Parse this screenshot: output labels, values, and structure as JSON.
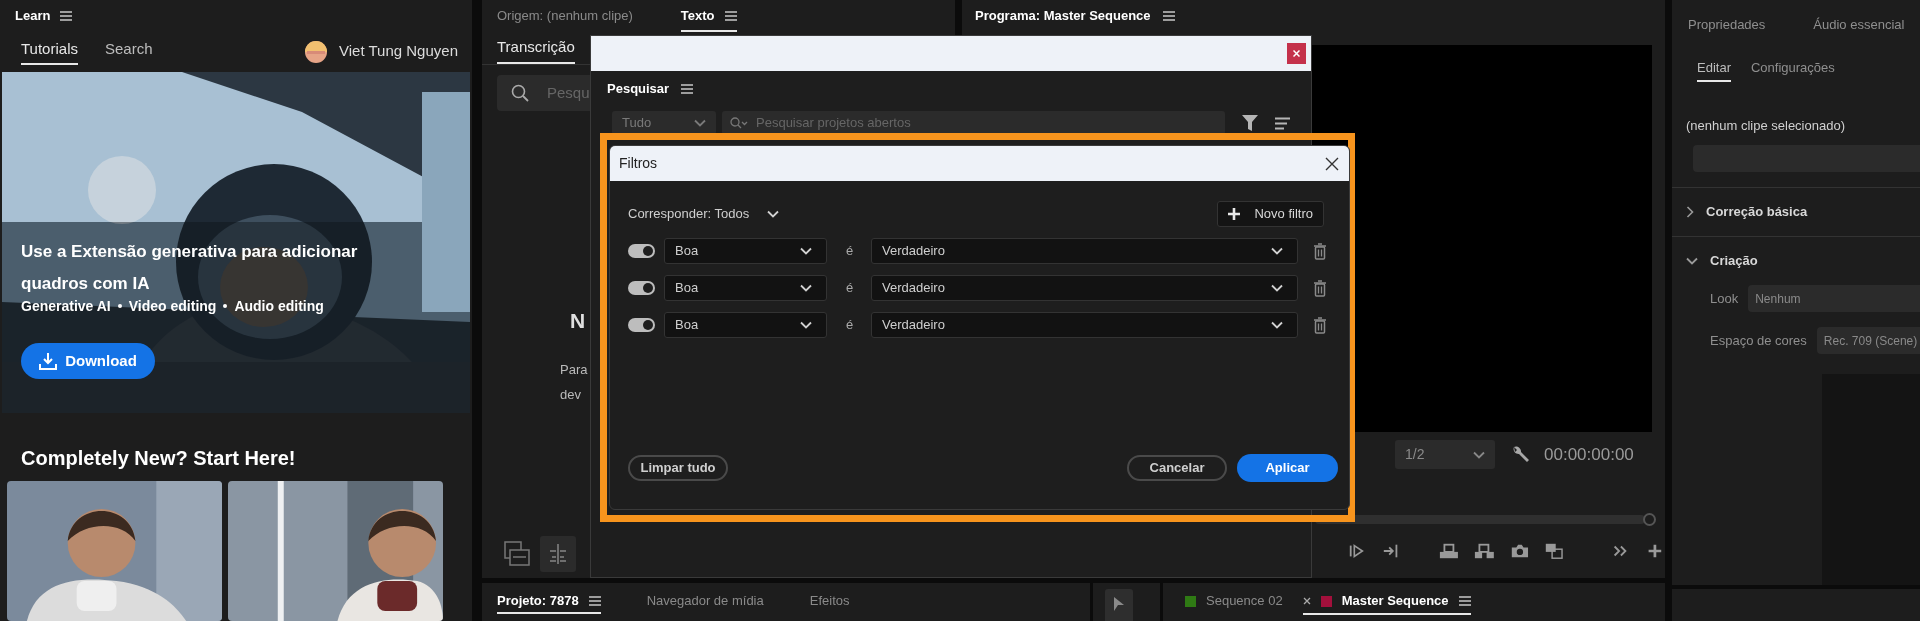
{
  "learn_panel": {
    "title": "Learn",
    "tabs": [
      {
        "label": "Tutorials",
        "selected": true
      },
      {
        "label": "Search",
        "selected": false
      }
    ],
    "user": {
      "name": "Viet Tung Nguyen"
    },
    "hero": {
      "kind": "picture",
      "title": "Use a Extensão generativa para adicionar quadros com IA",
      "tags": [
        "Generative AI",
        "Video editing",
        "Audio editing"
      ],
      "button": "Download"
    },
    "section_heading": "Completely New? Start Here!"
  },
  "text_panel": {
    "tabs": [
      {
        "label": "Origem: (nenhum clipe)",
        "selected": false
      },
      {
        "label": "Texto",
        "selected": true
      }
    ],
    "subtabs": [
      {
        "label": "Transcrição",
        "selected": true
      }
    ],
    "search_placeholder": "Pesqu",
    "message_fragments": [
      "N",
      "Para",
      "dev"
    ]
  },
  "program_panel": {
    "title": "Programa: Master Sequence",
    "zoom": "1/2",
    "timecode": "00:00:00:00"
  },
  "properties_panel": {
    "tabs": [
      "Propriedades",
      "Áudio essencial"
    ],
    "subtabs": [
      {
        "label": "Editar",
        "selected": true
      },
      {
        "label": "Configurações",
        "selected": false
      }
    ],
    "clip_label": "(nenhum clipe selecionado)",
    "sections": [
      {
        "title": "Correção básica",
        "expanded": false
      },
      {
        "title": "Criação",
        "expanded": true,
        "fields": [
          {
            "label": "Look",
            "value": "Nenhum"
          },
          {
            "label": "Espaço de cores",
            "value": "Rec. 709 (Scene)"
          }
        ]
      }
    ]
  },
  "bottom_panel": {
    "project_tabs": [
      {
        "label": "Projeto: 7878",
        "selected": true
      },
      {
        "label": "Navegador de mídia",
        "selected": false
      },
      {
        "label": "Efeitos",
        "selected": false
      }
    ],
    "sequences": [
      {
        "label": "Sequence 02",
        "color": "#2f7a14",
        "selected": false
      },
      {
        "label": "Master Sequence",
        "color": "#a3103c",
        "selected": true
      }
    ]
  },
  "search_dialog": {
    "title": "Pesquisar",
    "scope": "Tudo",
    "placeholder": "Pesquisar projetos abertos"
  },
  "filter_dialog": {
    "title": "Filtros",
    "match": "Corresponder: Todos",
    "new_filter": "Novo filtro",
    "filters": [
      {
        "on": true,
        "field": "Boa",
        "operator": "é",
        "value": "Verdadeiro"
      },
      {
        "on": true,
        "field": "Boa",
        "operator": "é",
        "value": "Verdadeiro"
      },
      {
        "on": true,
        "field": "Boa",
        "operator": "é",
        "value": "Verdadeiro"
      }
    ],
    "clear_button": "Limpar tudo",
    "cancel_button": "Cancelar",
    "apply_button": "Aplicar"
  }
}
